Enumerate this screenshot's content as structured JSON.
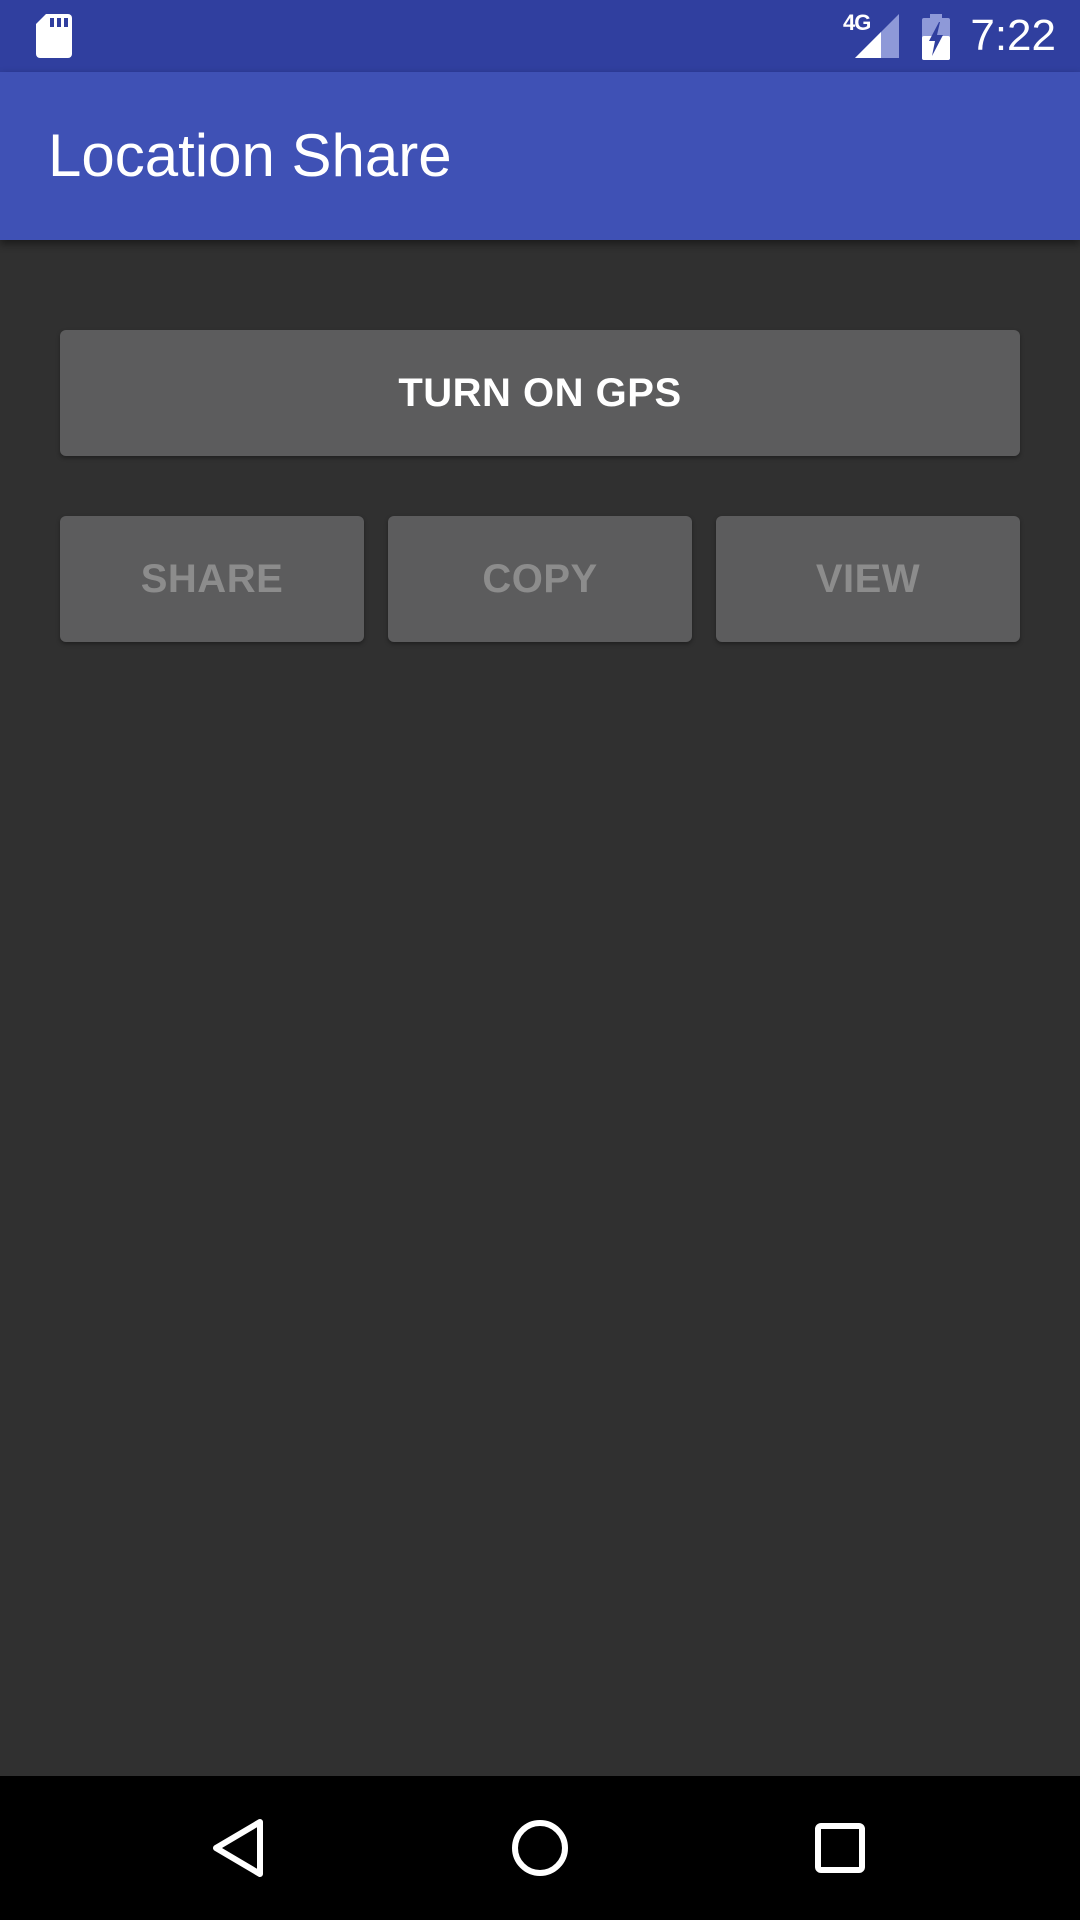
{
  "status_bar": {
    "time": "7:22",
    "network_type": "4G",
    "icons": [
      "sd-card-icon",
      "cellular-signal-icon",
      "battery-charging-icon"
    ]
  },
  "app_bar": {
    "title": "Location Share"
  },
  "main": {
    "gps_button_label": "TURN ON GPS",
    "share_button_label": "SHARE",
    "copy_button_label": "COPY",
    "view_button_label": "VIEW"
  },
  "nav_bar": {
    "icons": [
      "back-icon",
      "home-icon",
      "recent-apps-icon"
    ]
  },
  "colors": {
    "status_bar": "#303F9F",
    "app_bar": "#3F51B5",
    "background": "#303030",
    "button": "#5C5C5D",
    "button_text_enabled": "#FFFFFF",
    "button_text_disabled": "#8C8C8C",
    "nav_bar": "#000000"
  }
}
